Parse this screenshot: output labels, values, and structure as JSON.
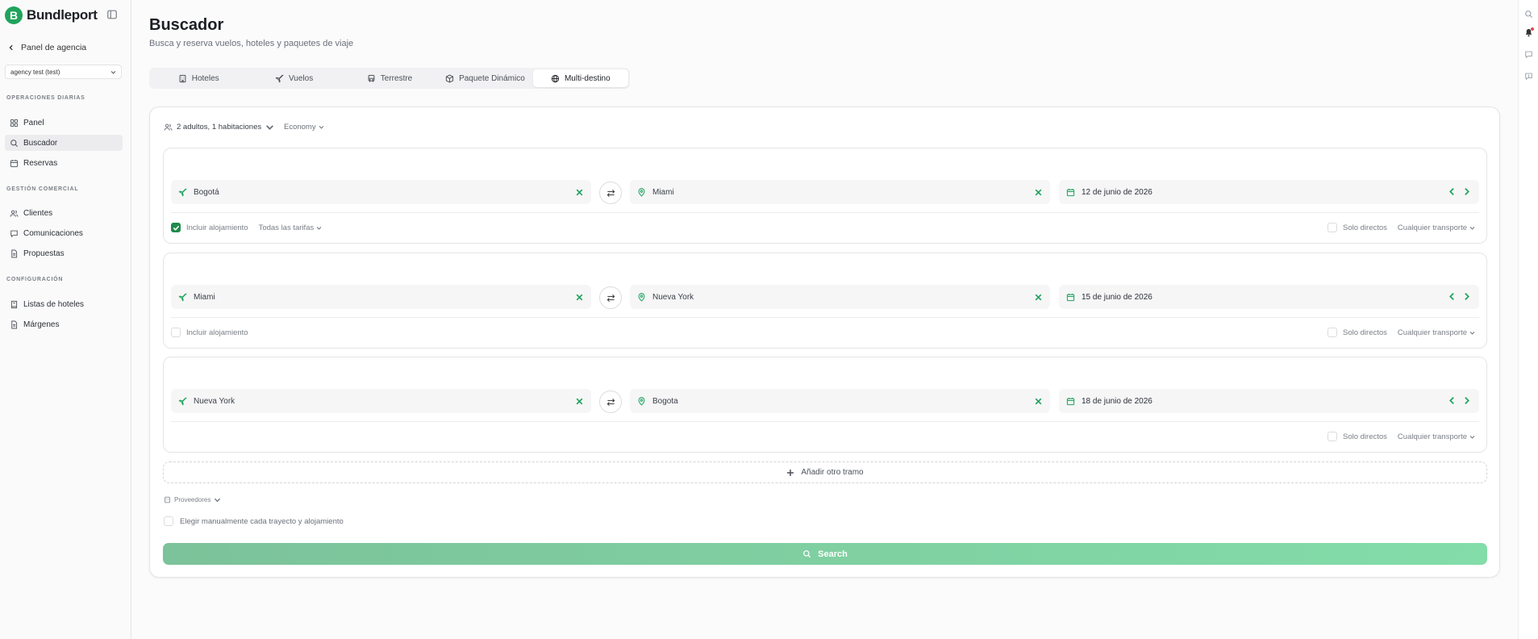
{
  "brand": {
    "mark": "B",
    "name": "Bundleport"
  },
  "sidebar": {
    "back_label": "Panel de agencia",
    "agency_value": "agency test (test)",
    "sections": {
      "daily": "OPERACIONES DIARIAS",
      "commercial": "GESTIÓN COMERCIAL",
      "config": "CONFIGURACIÓN"
    },
    "items": [
      {
        "label": "Panel",
        "icon": "grid-icon"
      },
      {
        "label": "Buscador",
        "icon": "search-icon",
        "active": true
      },
      {
        "label": "Reservas",
        "icon": "calendar-icon"
      },
      {
        "label": "Clientes",
        "icon": "users-icon"
      },
      {
        "label": "Comunicaciones",
        "icon": "message-icon"
      },
      {
        "label": "Propuestas",
        "icon": "document-icon"
      },
      {
        "label": "Listas de hoteles",
        "icon": "book-icon"
      },
      {
        "label": "Márgenes",
        "icon": "document-icon"
      }
    ]
  },
  "header": {
    "title": "Buscador",
    "subtitle": "Busca y reserva vuelos, hoteles y paquetes de viaje"
  },
  "tabs": [
    {
      "label": "Hoteles",
      "icon": "hotel-icon"
    },
    {
      "label": "Vuelos",
      "icon": "plane-icon"
    },
    {
      "label": "Terrestre",
      "icon": "bus-icon"
    },
    {
      "label": "Paquete Dinámico",
      "icon": "package-icon"
    },
    {
      "label": "Multi-destino",
      "icon": "globe-icon",
      "active": true
    }
  ],
  "search": {
    "travelers": "2 adultos, 1 habitaciones",
    "cabin": "Economy",
    "legs": [
      {
        "origin": "Bogotá",
        "destination": "Miami",
        "date": "12 de junio de 2026",
        "include_lodging": "Incluir alojamiento",
        "include_checked": true,
        "fares": "Todas las tarifas",
        "direct_only": "Solo directos",
        "transport": "Cualquier transporte"
      },
      {
        "origin": "Miami",
        "destination": "Nueva York",
        "date": "15 de junio de 2026",
        "include_lodging": "Incluir alojamiento",
        "include_checked": false,
        "direct_only": "Solo directos",
        "transport": "Cualquier transporte"
      },
      {
        "origin": "Nueva York",
        "destination": "Bogota",
        "date": "18 de junio de 2026",
        "direct_only": "Solo directos",
        "transport": "Cualquier transporte"
      }
    ],
    "add_leg": "Añadir otro tramo",
    "providers": "Proveedores",
    "manual_choose": "Elegir manualmente cada trayecto y alojamiento",
    "submit": "Search"
  },
  "colors": {
    "accent": "#1fa35b",
    "checkbox": "#1f8a4c",
    "search_start": "#7cc29a",
    "search_end": "#83dda9"
  }
}
